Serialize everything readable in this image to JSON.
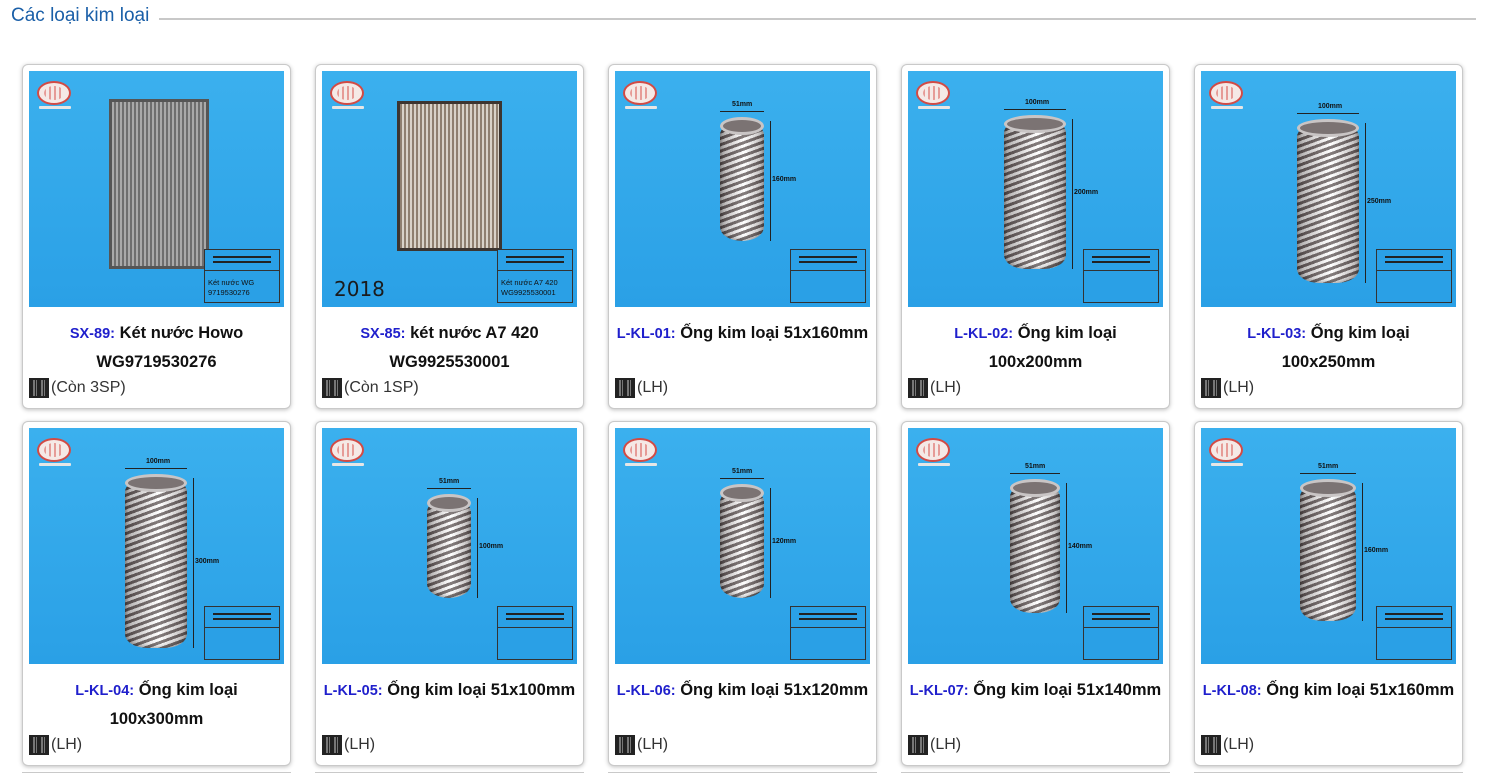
{
  "section": {
    "title": "Các loại kim loại"
  },
  "products": [
    {
      "code": "SX-89:",
      "name": "Két nước Howo WG9719530276",
      "stock": "(Còn 3SP)",
      "image": "radiator",
      "image_text": "Két nước WG 9719530276"
    },
    {
      "code": "SX-85:",
      "name": "két nước A7 420 WG9925530001",
      "stock": "(Còn 1SP)",
      "image": "radiator-dark",
      "image_text": "Két nước A7 420 WG9925530001",
      "year": "2018"
    },
    {
      "code": "L-KL-01:",
      "name": "Ống kim loại 51x160mm",
      "stock": "(LH)",
      "image": "pipe",
      "dims": [
        "51mm",
        "160mm"
      ]
    },
    {
      "code": "L-KL-02:",
      "name": "Ống kim loại 100x200mm",
      "stock": "(LH)",
      "image": "pipe",
      "dims": [
        "100mm",
        "200mm"
      ]
    },
    {
      "code": "L-KL-03:",
      "name": "Ống kim loại 100x250mm",
      "stock": "(LH)",
      "image": "pipe",
      "dims": [
        "100mm",
        "250mm"
      ]
    },
    {
      "code": "L-KL-04:",
      "name": "Ống kim loại 100x300mm",
      "stock": "(LH)",
      "image": "pipe",
      "dims": [
        "100mm",
        "300mm"
      ]
    },
    {
      "code": "L-KL-05:",
      "name": "Ống kim loại 51x100mm",
      "stock": "(LH)",
      "image": "pipe",
      "dims": [
        "51mm",
        "100mm"
      ]
    },
    {
      "code": "L-KL-06:",
      "name": "Ống kim loại 51x120mm",
      "stock": "(LH)",
      "image": "pipe",
      "dims": [
        "51mm",
        "120mm"
      ]
    },
    {
      "code": "L-KL-07:",
      "name": "Ống kim loại 51x140mm",
      "stock": "(LH)",
      "image": "pipe",
      "dims": [
        "51mm",
        "140mm"
      ]
    },
    {
      "code": "L-KL-08:",
      "name": "Ống kim loại 51x160mm",
      "stock": "(LH)",
      "image": "pipe",
      "dims": [
        "51mm",
        "160mm"
      ]
    }
  ],
  "colors": {
    "section_title": "#1a5fa8",
    "product_code": "#1f1fcc",
    "thumb_bg": "#2aa0e6"
  },
  "icons": {
    "qr": "qr-code-icon",
    "logo": "company-logo-icon"
  }
}
